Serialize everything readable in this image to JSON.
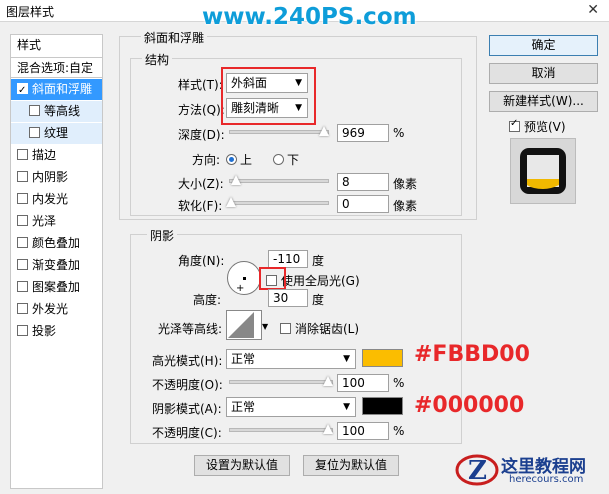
{
  "window": {
    "title": "图层样式",
    "close": "✕"
  },
  "watermark": "www.240PS.com",
  "stylelist": {
    "header": "样式",
    "blend": "混合选项:自定",
    "items": [
      {
        "label": "斜面和浮雕",
        "checked": true,
        "selected": true
      },
      {
        "label": "等高线",
        "checked": false,
        "sub": true
      },
      {
        "label": "纹理",
        "checked": false,
        "sub": true
      },
      {
        "label": "描边",
        "checked": false
      },
      {
        "label": "内阴影",
        "checked": false
      },
      {
        "label": "内发光",
        "checked": false
      },
      {
        "label": "光泽",
        "checked": false
      },
      {
        "label": "颜色叠加",
        "checked": false
      },
      {
        "label": "渐变叠加",
        "checked": false
      },
      {
        "label": "图案叠加",
        "checked": false
      },
      {
        "label": "外发光",
        "checked": false
      },
      {
        "label": "投影",
        "checked": false
      }
    ]
  },
  "buttons": {
    "ok": "确定",
    "cancel": "取消",
    "new_style": "新建样式(W)...",
    "preview_label": "预览(V)",
    "preview_checked": true
  },
  "bevel": {
    "section_title": "斜面和浮雕",
    "structure_title": "结构",
    "style_label": "样式(T):",
    "style_value": "外斜面",
    "technique_label": "方法(Q):",
    "technique_value": "雕刻清晰",
    "depth_label": "深度(D):",
    "depth_value": "969",
    "depth_unit": "%",
    "direction_label": "方向:",
    "direction_up": "上",
    "direction_down": "下",
    "size_label": "大小(Z):",
    "size_value": "8",
    "size_unit": "像素",
    "soften_label": "软化(F):",
    "soften_value": "0",
    "soften_unit": "像素"
  },
  "shading": {
    "title": "阴影",
    "angle_label": "角度(N):",
    "angle_value": "-110",
    "angle_unit": "度",
    "global_light_label": "使用全局光(G)",
    "altitude_label": "高度:",
    "altitude_value": "30",
    "altitude_unit": "度",
    "gloss_label": "光泽等高线:",
    "antialias_label": "消除锯齿(L)",
    "highlight_mode_label": "高光模式(H):",
    "highlight_mode_value": "正常",
    "highlight_color": "#FBBD00",
    "highlight_hex_label": "#FBBD00",
    "opacity1_label": "不透明度(O):",
    "opacity1_value": "100",
    "opacity1_unit": "%",
    "shadow_mode_label": "阴影模式(A):",
    "shadow_mode_value": "正常",
    "shadow_color": "#000000",
    "shadow_hex_label": "#000000",
    "opacity2_label": "不透明度(C):",
    "opacity2_value": "100",
    "opacity2_unit": "%",
    "set_default": "设置为默认值",
    "reset_default": "复位为默认值"
  },
  "logo": {
    "main": "这里教程网",
    "sub": "herecours.com"
  }
}
